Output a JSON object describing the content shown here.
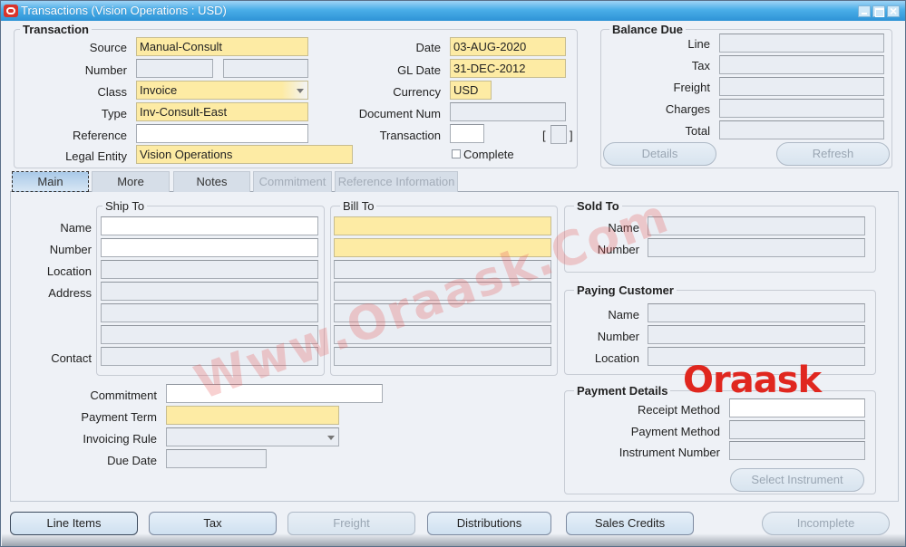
{
  "window": {
    "title": "Transactions (Vision Operations : USD)",
    "controls": [
      "minimize",
      "maximize",
      "close"
    ]
  },
  "transaction": {
    "heading": "Transaction",
    "source": {
      "label": "Source",
      "value": "Manual-Consult"
    },
    "number": {
      "label": "Number",
      "value": "",
      "value2": ""
    },
    "class": {
      "label": "Class",
      "value": "Invoice"
    },
    "type": {
      "label": "Type",
      "value": "Inv-Consult-East"
    },
    "reference": {
      "label": "Reference",
      "value": ""
    },
    "legal_entity": {
      "label": "Legal Entity",
      "value": "Vision Operations"
    },
    "date": {
      "label": "Date",
      "value": "03-AUG-2020"
    },
    "gl_date": {
      "label": "GL Date",
      "value": "31-DEC-2012"
    },
    "currency": {
      "label": "Currency",
      "value": "USD"
    },
    "document_num": {
      "label": "Document Num",
      "value": ""
    },
    "transaction_field": {
      "label": "Transaction",
      "value": ""
    },
    "bracket_open": "[",
    "bracket_close": "]",
    "complete": {
      "label": "Complete",
      "checked": false
    }
  },
  "balance_due": {
    "heading": "Balance Due",
    "rows": [
      {
        "label": "Line",
        "value": ""
      },
      {
        "label": "Tax",
        "value": ""
      },
      {
        "label": "Freight",
        "value": ""
      },
      {
        "label": "Charges",
        "value": ""
      },
      {
        "label": "Total",
        "value": ""
      }
    ],
    "details_button": "Details",
    "refresh_button": "Refresh"
  },
  "tabs": [
    {
      "label": "Main",
      "active": true,
      "enabled": true
    },
    {
      "label": "More",
      "active": false,
      "enabled": true
    },
    {
      "label": "Notes",
      "active": false,
      "enabled": true
    },
    {
      "label": "Commitment",
      "active": false,
      "enabled": false
    },
    {
      "label": "Reference Information",
      "active": false,
      "enabled": false
    }
  ],
  "ship_to": {
    "heading": "Ship To",
    "labels": {
      "name": "Name",
      "number": "Number",
      "location": "Location",
      "address": "Address",
      "contact": "Contact"
    },
    "name": "",
    "number": "",
    "location": "",
    "address1": "",
    "address2": "",
    "address3": "",
    "contact": ""
  },
  "bill_to": {
    "heading": "Bill To",
    "name": "",
    "number": "",
    "location": "",
    "address1": "",
    "address2": "",
    "address3": "",
    "contact": ""
  },
  "sold_to": {
    "heading": "Sold To",
    "name": {
      "label": "Name",
      "value": ""
    },
    "number": {
      "label": "Number",
      "value": ""
    }
  },
  "paying_customer": {
    "heading": "Paying Customer",
    "name": {
      "label": "Name",
      "value": ""
    },
    "number": {
      "label": "Number",
      "value": ""
    },
    "location": {
      "label": "Location",
      "value": ""
    }
  },
  "payment_details": {
    "heading": "Payment Details",
    "receipt_method": {
      "label": "Receipt Method",
      "value": ""
    },
    "payment_method": {
      "label": "Payment Method",
      "value": ""
    },
    "instrument_number": {
      "label": "Instrument Number",
      "value": ""
    },
    "select_instrument_button": "Select Instrument"
  },
  "terms": {
    "commitment": {
      "label": "Commitment",
      "value": ""
    },
    "payment_term": {
      "label": "Payment Term",
      "value": ""
    },
    "invoicing_rule": {
      "label": "Invoicing Rule",
      "value": ""
    },
    "due_date": {
      "label": "Due Date",
      "value": ""
    }
  },
  "bottom_buttons": {
    "line_items": "Line Items",
    "tax": "Tax",
    "freight": "Freight",
    "distributions": "Distributions",
    "sales_credits": "Sales Credits",
    "incomplete": "Incomplete"
  },
  "watermarks": {
    "site": "Www.Oraask.Com",
    "logo": "Oraask"
  },
  "colors": {
    "required_field": "#fdeba4",
    "titlebar": "#3a9edc",
    "panel_bg": "#eef1f6"
  }
}
